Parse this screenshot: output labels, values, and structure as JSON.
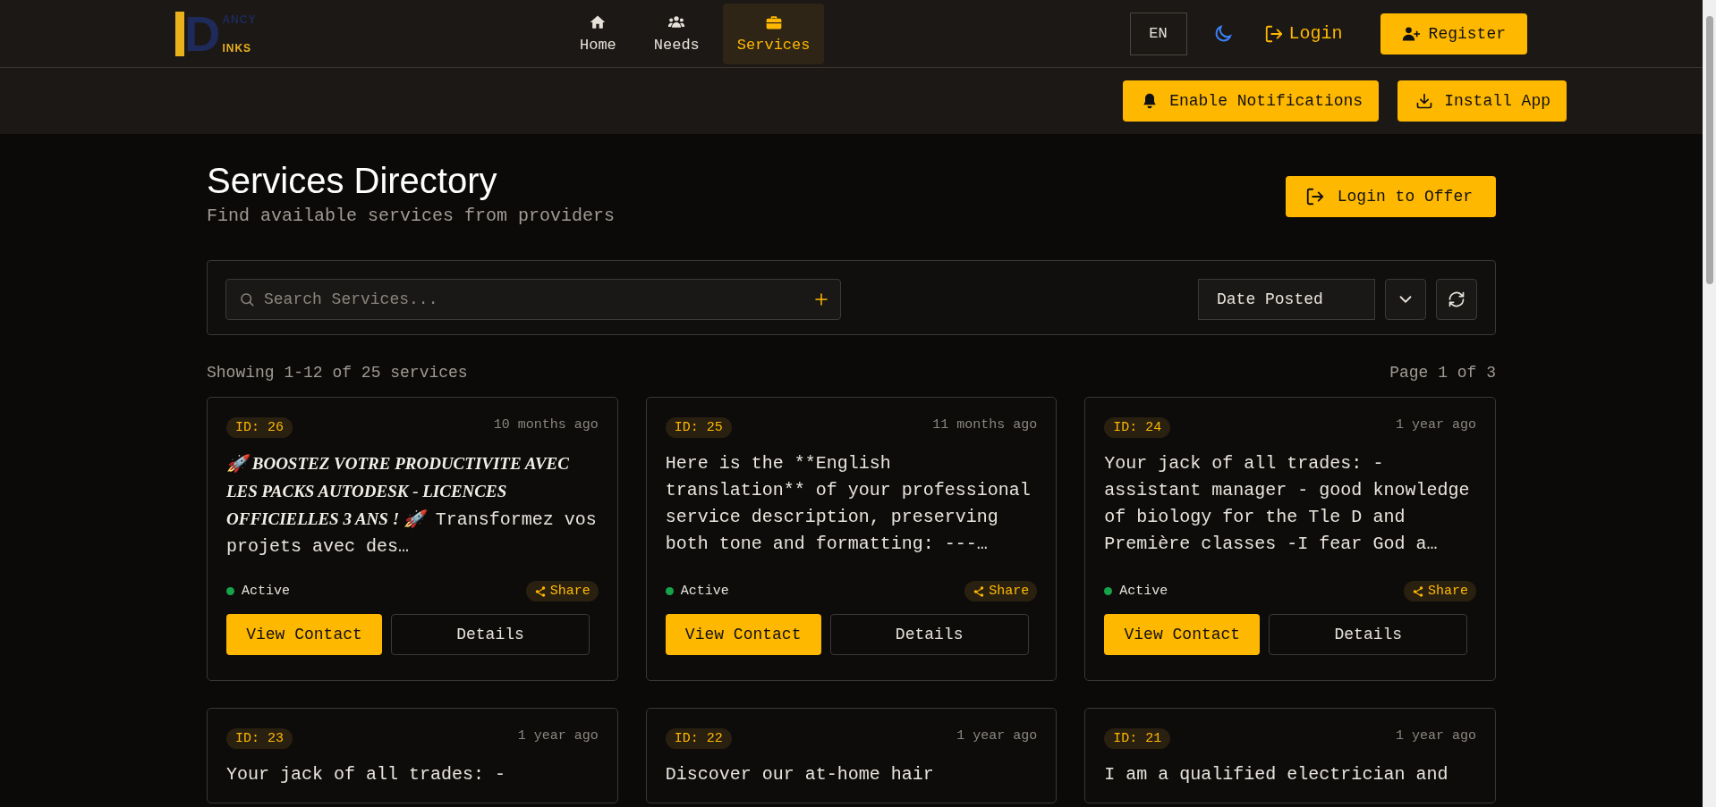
{
  "logo": {
    "initial": "D",
    "top": "ANCY",
    "bottom": "INKS"
  },
  "nav": [
    {
      "label": "Home",
      "selected": false
    },
    {
      "label": "Needs",
      "selected": false
    },
    {
      "label": "Services",
      "selected": true
    }
  ],
  "header_actions": {
    "language": "EN",
    "login": "Login",
    "register": "Register"
  },
  "toolbar": {
    "notifications": "Enable Notifications",
    "install": "Install App"
  },
  "page": {
    "title": "Services Directory",
    "subtitle": "Find available services from providers",
    "offer_button": "Login to Offer"
  },
  "filters": {
    "search_placeholder": "Search Services...",
    "sort": "Date Posted"
  },
  "results": {
    "showing": "Showing 1-12 of 25 services",
    "page": "Page 1 of 3"
  },
  "services": [
    {
      "id": "ID: 26",
      "time": "10 months ago",
      "heading": "🚀 BOOSTEZ VOTRE PRODUCTIVITE AVEC LES PACKS AUTODESK - LICENCES OFFICIELLES 3 ANS ! 🚀",
      "text": "Transformez vos projets avec des…",
      "status": "Active",
      "active": true,
      "share": "Share",
      "contact": "View Contact",
      "details": "Details"
    },
    {
      "id": "ID: 25",
      "time": "11 months ago",
      "text": "Here is the **English translation** of your professional service description, preserving both tone and formatting: ---…",
      "status": "Active",
      "active": true,
      "share": "Share",
      "contact": "View Contact",
      "details": "Details"
    },
    {
      "id": "ID: 24",
      "time": "1 year ago",
      "text": "Your jack of all trades: - assistant manager - good knowledge of biology for the Tle D and Première classes -I fear God a…",
      "status": "Active",
      "active": true,
      "share": "Share",
      "contact": "View Contact",
      "details": "Details"
    },
    {
      "id": "ID: 23",
      "time": "1 year ago",
      "text": "Your jack of all trades: -"
    },
    {
      "id": "ID: 22",
      "time": "1 year ago",
      "text": "Discover our at-home hair"
    },
    {
      "id": "ID: 21",
      "time": "1 year ago",
      "text": "I am a qualified electrician and"
    }
  ]
}
